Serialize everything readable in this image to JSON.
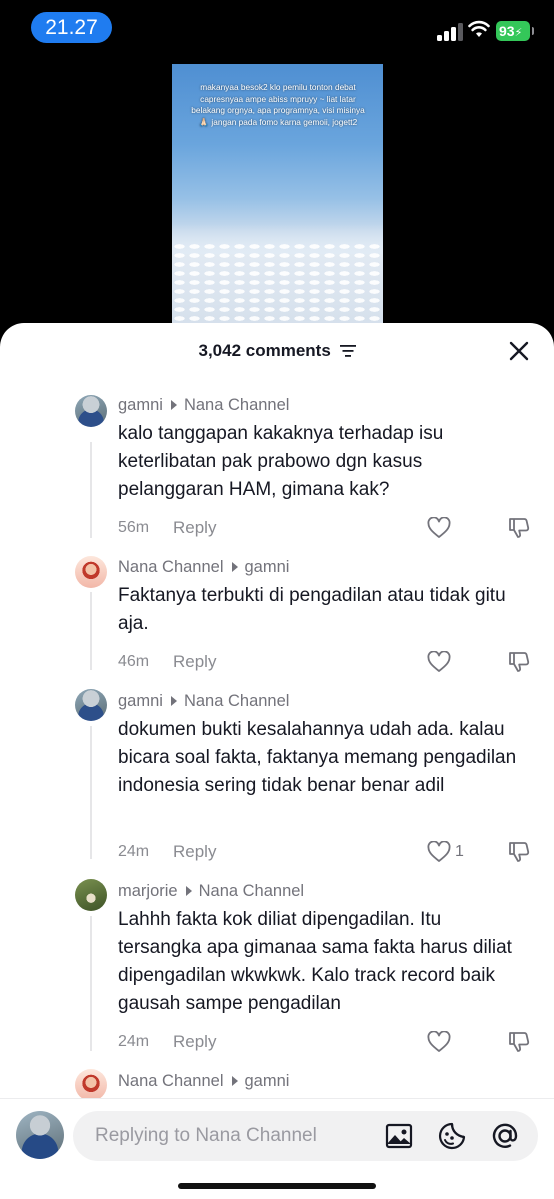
{
  "status_bar": {
    "time": "21.27",
    "battery": "93"
  },
  "video": {
    "caption": "makanyaa besok2 klo pemilu tonton debat capresnyaa ampe abiss mpruyy ~ liat latar belakang orgnya, apa programnya, visi misinya 🙏🏻 jangan pada fomo karna gemoii, jogett2"
  },
  "header": {
    "comment_count": "3,042 comments"
  },
  "comments": [
    {
      "user": "gamni",
      "reply_to": "Nana Channel",
      "text": "kalo tanggapan kakaknya terhadap isu keterlibatan pak prabowo dgn kasus pelanggaran HAM, gimana kak?",
      "age": "56m",
      "reply_label": "Reply",
      "likes": ""
    },
    {
      "user": "Nana Channel",
      "reply_to": "gamni",
      "text": "Faktanya terbukti di pengadilan atau tidak gitu aja.",
      "age": "46m",
      "reply_label": "Reply",
      "likes": ""
    },
    {
      "user": "gamni",
      "reply_to": "Nana Channel",
      "text": "dokumen bukti kesalahannya udah ada. kalau bicara soal fakta, faktanya memang pengadilan indonesia sering tidak benar benar adil",
      "age": "24m",
      "reply_label": "Reply",
      "likes": "1"
    },
    {
      "user": "marjorie",
      "reply_to": "Nana Channel",
      "text": "Lahhh fakta kok diliat dipengadilan. Itu tersangka apa gimanaa sama fakta harus diliat dipengadilan wkwkwk. Kalo track record baik gausah sampe pengadilan",
      "age": "24m",
      "reply_label": "Reply",
      "likes": ""
    },
    {
      "user": "Nana Channel",
      "reply_to": "gamni"
    }
  ],
  "reply_bar": {
    "placeholder": "Replying to Nana Channel"
  },
  "icons": {
    "filter": "filter-icon",
    "close": "close-icon",
    "like": "heart-outline-icon",
    "dislike": "thumbs-down-icon",
    "image": "image-icon",
    "emoji": "emoji-sticker-icon",
    "mention": "at-mention-icon"
  }
}
